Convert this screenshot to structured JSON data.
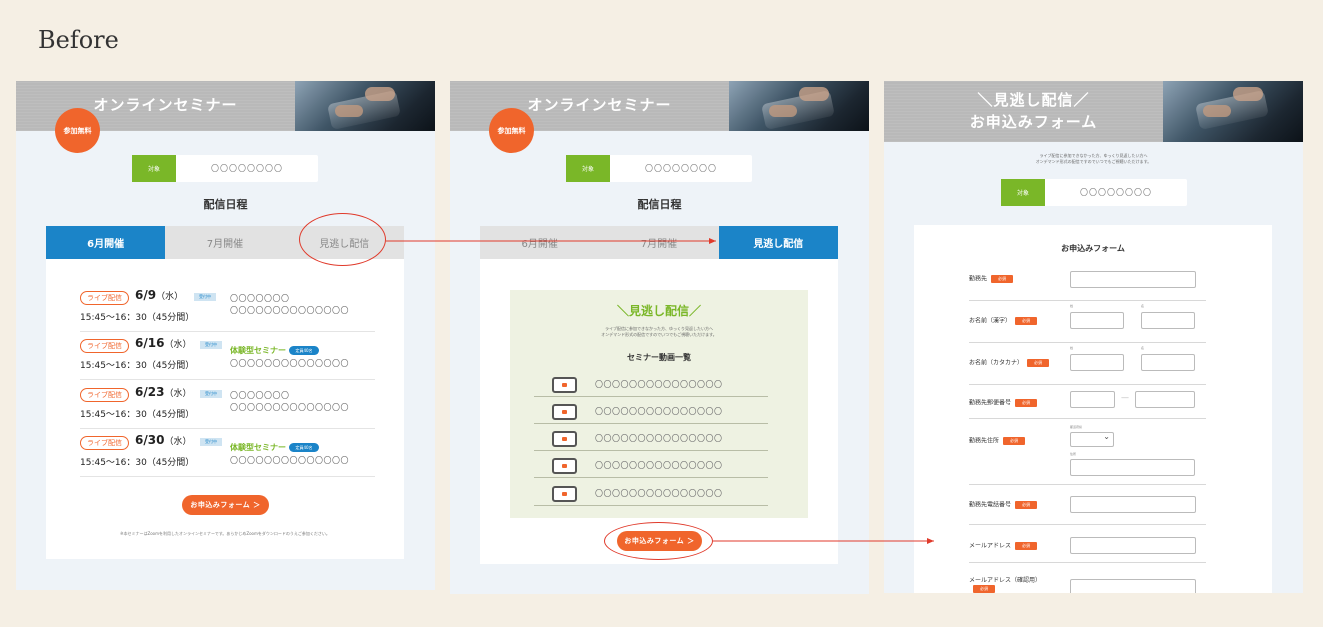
{
  "heading": "Before",
  "panel1": {
    "hero_title": "オンラインセミナー",
    "badge": "参加無料",
    "target_label": "対象",
    "target_value": "〇〇〇〇〇〇〇〇",
    "section_title": "配信日程",
    "tabs": [
      "6月開催",
      "7月開催",
      "見逃し配信"
    ],
    "active_tab": 0,
    "schedule": [
      {
        "type": "ライブ配信",
        "date": "6/9",
        "weekday": "（水）",
        "recv": "受付中",
        "time": "15:45〜16：30（45分間）",
        "line1": "〇〇〇〇〇〇〇",
        "line2": "〇〇〇〇〇〇〇〇〇〇〇〇〇〇",
        "exp": "",
        "cap": ""
      },
      {
        "type": "ライブ配信",
        "date": "6/16",
        "weekday": "（水）",
        "recv": "受付中",
        "time": "15:45〜16：30（45分間）",
        "line1": "",
        "line2": "〇〇〇〇〇〇〇〇〇〇〇〇〇〇",
        "exp": "体験型セミナー",
        "cap": "定員40名"
      },
      {
        "type": "ライブ配信",
        "date": "6/23",
        "weekday": "（水）",
        "recv": "受付中",
        "time": "15:45〜16：30（45分間）",
        "line1": "〇〇〇〇〇〇〇",
        "line2": "〇〇〇〇〇〇〇〇〇〇〇〇〇〇",
        "exp": "",
        "cap": ""
      },
      {
        "type": "ライブ配信",
        "date": "6/30",
        "weekday": "（水）",
        "recv": "受付中",
        "time": "15:45〜16：30（45分間）",
        "line1": "",
        "line2": "〇〇〇〇〇〇〇〇〇〇〇〇〇〇",
        "exp": "体験型セミナー",
        "cap": "定員40名"
      }
    ],
    "cta": "お申込みフォーム ＞",
    "note": "※本セミナーはZoomを利用したオンラインセミナーです。あらかじめZoomをダウンロードのうえご参加ください。"
  },
  "panel2": {
    "hero_title": "オンラインセミナー",
    "badge": "参加無料",
    "target_label": "対象",
    "target_value": "〇〇〇〇〇〇〇〇",
    "section_title": "配信日程",
    "tabs": [
      "6月開催",
      "7月開催",
      "見逃し配信"
    ],
    "active_tab": 2,
    "box_title": "＼見逃し配信／",
    "box_desc_1": "ライブ配信に参加できなかった方、ゆっくり見返したい方へ",
    "box_desc_2": "オンデマンド形式の配信ですのでいつでもご視聴いただけます。",
    "box_subtitle": "セミナー動画一覧",
    "videos": [
      "〇〇〇〇〇〇〇〇〇〇〇〇〇〇〇",
      "〇〇〇〇〇〇〇〇〇〇〇〇〇〇〇",
      "〇〇〇〇〇〇〇〇〇〇〇〇〇〇〇",
      "〇〇〇〇〇〇〇〇〇〇〇〇〇〇〇",
      "〇〇〇〇〇〇〇〇〇〇〇〇〇〇〇"
    ],
    "cta": "お申込みフォーム ＞"
  },
  "panel3": {
    "hero_line1": "＼見逃し配信／",
    "hero_line2": "お申込みフォーム",
    "desc_1": "ライブ配信に参加できなかった方、ゆっくり見返したい方へ",
    "desc_2": "オンデマンド形式の配信ですのでいつでもご視聴いただけます。",
    "target_label": "対象",
    "target_value": "〇〇〇〇〇〇〇〇",
    "form_title": "お申込みフォーム",
    "required": "必須",
    "fields": {
      "company": "勤務先",
      "name_kanji": "お名前（漢字）",
      "name_kana": "お名前（カタカナ）",
      "zip": "勤務先郵便番号",
      "address": "勤務先住所",
      "phone": "勤務先電話番号",
      "email": "メールアドレス",
      "email_confirm": "メールアドレス（確認用）"
    },
    "sei": "姓",
    "mei": "名",
    "pref": "都道府県",
    "addr": "住所",
    "zip_dash": "—"
  },
  "colors": {
    "orange": "#f0652c",
    "blue": "#1b84c8",
    "green": "#7ab728",
    "annotation_red": "#e03a2b"
  }
}
